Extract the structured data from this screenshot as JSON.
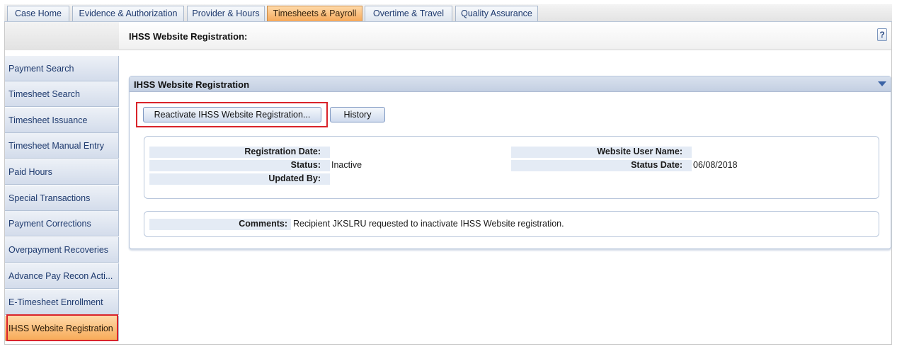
{
  "tabs": [
    {
      "label": "Case Home"
    },
    {
      "label": "Evidence & Authorization"
    },
    {
      "label": "Provider & Hours"
    },
    {
      "label": "Timesheets & Payroll"
    },
    {
      "label": "Overtime & Travel"
    },
    {
      "label": "Quality Assurance"
    }
  ],
  "sidebar": {
    "items": [
      {
        "label": "Payment Search"
      },
      {
        "label": "Timesheet Search"
      },
      {
        "label": "Timesheet Issuance"
      },
      {
        "label": "Timesheet Manual Entry"
      },
      {
        "label": "Paid Hours"
      },
      {
        "label": "Special Transactions"
      },
      {
        "label": "Payment Corrections"
      },
      {
        "label": "Overpayment Recoveries"
      },
      {
        "label": "Advance Pay Recon Acti..."
      },
      {
        "label": "E-Timesheet Enrollment"
      },
      {
        "label": "IHSS Website Registration"
      }
    ],
    "active_index": 10
  },
  "page": {
    "title": "IHSS Website Registration:",
    "help_label": "?"
  },
  "panel": {
    "title": "IHSS Website Registration",
    "buttons": {
      "reactivate": "Reactivate IHSS Website Registration...",
      "history": "History"
    },
    "fields": {
      "registration_date": {
        "label": "Registration Date:",
        "value": ""
      },
      "status": {
        "label": "Status:",
        "value": "Inactive"
      },
      "updated_by": {
        "label": "Updated By:",
        "value": ""
      },
      "website_user_name": {
        "label": "Website User Name:",
        "value": ""
      },
      "status_date": {
        "label": "Status Date:",
        "value": "06/08/2018"
      }
    },
    "comments": {
      "label": "Comments:",
      "value": "Recipient JKSLRU requested to inactivate IHSS Website registration."
    }
  },
  "colors": {
    "active_tab": "#f5a95b",
    "highlight_border": "#d9232a",
    "panel_header": "#c3cfe2"
  }
}
